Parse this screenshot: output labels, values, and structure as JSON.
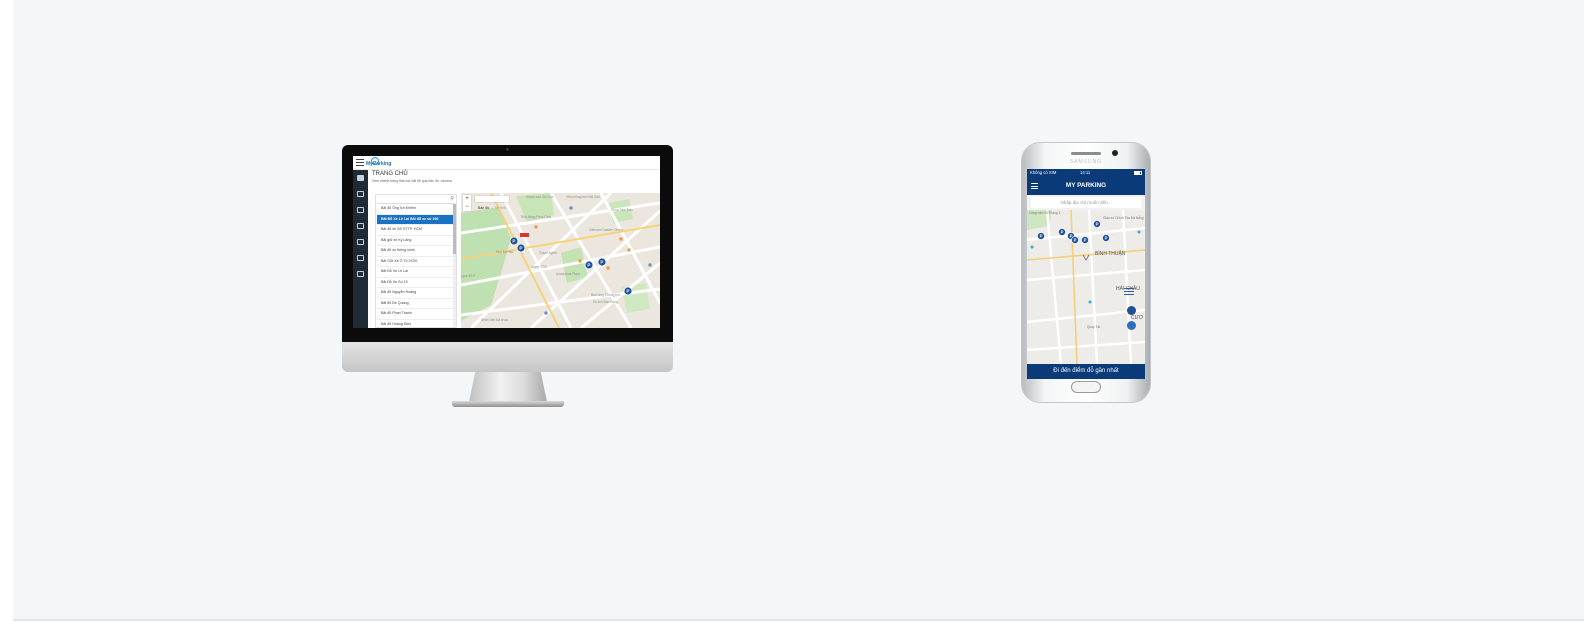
{
  "desktop": {
    "app": {
      "logo_text": "MyParking",
      "page_title": "TRANG CHỦ",
      "page_subtitle": "Xem nhanh trạng thái các bãi đỗ qua bản đồ, camera",
      "parking_lots": [
        "Bãi đỗ Ông Ích Khiêm",
        "Bãi Đỗ Xe Lê Lai Bãi đỗ xe số 196",
        "Bãi đỗ xe Sở GTTP. HCM",
        "Bãi giữ xe Kỳ Lăng",
        "Bãi đỗ xe thông minh",
        "Bãi Giữ Xe Ô Tô 2X3X",
        "Bãi Đỗ Xe Lê Lai",
        "Bãi Đỗ Xe Số 15",
        "Bãi đỗ Nguyễn Hoàng",
        "Bãi đỗ Đồ Quang",
        "Bãi đỗ Phan Thanh",
        "Bãi đỗ Hoàng Diệu"
      ],
      "active_lot_index": 1,
      "map": {
        "zoom_in": "+",
        "zoom_out": "−",
        "type_map": "Bản đồ",
        "type_satellite": "Vệ tinh",
        "labels": [
          "Nhà Hàng Phúc Cafe",
          "Vietnam Coaster Center",
          "Travel Agent",
          "Agent TTIC",
          "Du lịch Bảo Hồng",
          "Bảo tàng Chứng tích",
          "Văn phòng bến Sài Gòn",
          "Chùa Tâm Đức",
          "Lyce 30-9",
          "Đền Bà Hậu",
          "Khách sạn Sài Gòn",
          "Ancoremnt Place",
          "Bệnh viện Đa khoa"
        ]
      }
    }
  },
  "phone": {
    "brand": "SAMSUNG",
    "status": {
      "carrier": "Không có SIM",
      "time": "14:11"
    },
    "app_title": "MY PARKING",
    "search_placeholder": "Nhập địa chỉ muốn đến...",
    "map_labels": [
      "Công viên 29 Tháng 3",
      "Giáo xứ Chính Tòa Đà Nẵng",
      "BÌNH THUẬN",
      "HẢI CHÂU",
      "CƯƠ",
      "Quay Tất"
    ],
    "cta_label": "Đi đến điểm đỗ gần nhất"
  },
  "colors": {
    "brand_dark_blue": "#0a3a78",
    "active_blue": "#1a73c2",
    "sidebar_dark": "#1e2a36",
    "marker_blue": "#1f4f98"
  }
}
